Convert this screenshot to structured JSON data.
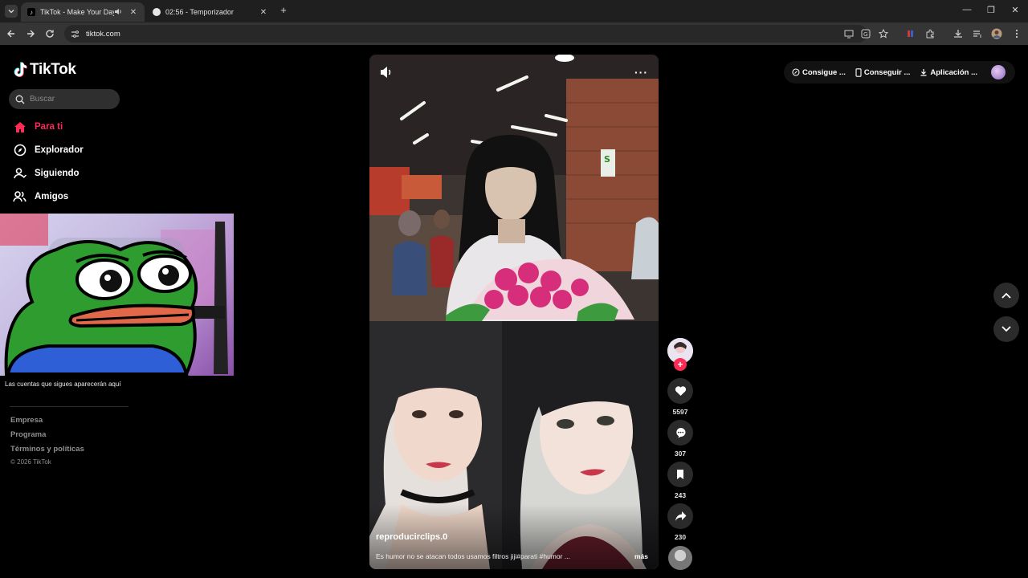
{
  "browser": {
    "tabs": [
      {
        "title": "TikTok - Make Your Day",
        "active": true
      },
      {
        "title": "02:56 - Temporizador",
        "active": false
      }
    ],
    "url": "tiktok.com"
  },
  "sidebar": {
    "brand": "TikTok",
    "search_placeholder": "Buscar",
    "nav": [
      {
        "label": "Para ti",
        "icon": "home-icon",
        "active": true
      },
      {
        "label": "Explorador",
        "icon": "compass-icon",
        "active": false
      },
      {
        "label": "Siguiendo",
        "icon": "user-follow-icon",
        "active": false
      },
      {
        "label": "Amigos",
        "icon": "friends-icon",
        "active": false
      }
    ],
    "follow_hint": "Las cuentas que sigues aparecerán aquí",
    "footer": [
      "Empresa",
      "Programa",
      "Términos y políticas"
    ],
    "copyright": "© 2026 TikTok"
  },
  "video": {
    "handle": "reproducirclips.0",
    "caption": "Es humor no se atacan todos usamos filtros jiji#parati #humor ...",
    "more_label": "más"
  },
  "actions": {
    "likes": "5597",
    "comments": "307",
    "saves": "243",
    "shares": "230"
  },
  "topbar": {
    "pills": [
      "Consigue ...",
      "Conseguir ...",
      "Aplicación ..."
    ]
  },
  "colors": {
    "accent": "#fe2c55",
    "background": "#000000"
  }
}
